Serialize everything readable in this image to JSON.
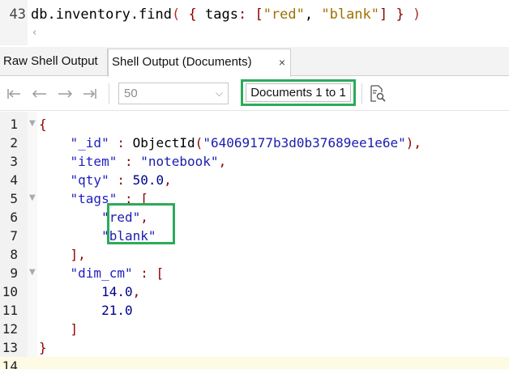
{
  "editor": {
    "line_number": "43",
    "query_parts": [
      {
        "text": "db.inventory.find",
        "cls": "tk-plain"
      },
      {
        "text": "(",
        "cls": "tk-paren"
      },
      {
        "text": " ",
        "cls": "tk-plain"
      },
      {
        "text": "{",
        "cls": "tk-brace"
      },
      {
        "text": " tags",
        "cls": "tk-plain"
      },
      {
        "text": ":",
        "cls": "tk-brace"
      },
      {
        "text": " ",
        "cls": "tk-plain"
      },
      {
        "text": "[",
        "cls": "tk-brace"
      },
      {
        "text": "\"red\"",
        "cls": "tk-str"
      },
      {
        "text": ", ",
        "cls": "tk-plain"
      },
      {
        "text": "\"blank\"",
        "cls": "tk-str"
      },
      {
        "text": "]",
        "cls": "tk-brace"
      },
      {
        "text": " ",
        "cls": "tk-plain"
      },
      {
        "text": "}",
        "cls": "tk-brace"
      },
      {
        "text": " ",
        "cls": "tk-plain"
      },
      {
        "text": ")",
        "cls": "tk-paren"
      }
    ]
  },
  "tabs": {
    "raw": "Raw Shell Output",
    "documents": "Shell Output (Documents)",
    "close_glyph": "×"
  },
  "toolbar": {
    "page_size": "50",
    "document_range": "Documents 1 to 1"
  },
  "result_lines": [
    {
      "n": "1",
      "fold": "▼",
      "parts": [
        [
          "{",
          "c-brace"
        ]
      ]
    },
    {
      "n": "2",
      "fold": "",
      "parts": [
        [
          "    ",
          "c-fn"
        ],
        [
          "\"_id\"",
          "c-key"
        ],
        [
          " : ",
          "c-colon"
        ],
        [
          "ObjectId",
          "c-fn"
        ],
        [
          "(",
          "c-punct"
        ],
        [
          "\"64069177b3d0b37689ee1e6e\"",
          "c-arg"
        ],
        [
          "),",
          "c-punct"
        ]
      ]
    },
    {
      "n": "3",
      "fold": "",
      "parts": [
        [
          "    ",
          "c-fn"
        ],
        [
          "\"item\"",
          "c-key"
        ],
        [
          " : ",
          "c-colon"
        ],
        [
          "\"notebook\"",
          "c-str"
        ],
        [
          ",",
          "c-punct"
        ]
      ]
    },
    {
      "n": "4",
      "fold": "",
      "parts": [
        [
          "    ",
          "c-fn"
        ],
        [
          "\"qty\"",
          "c-key"
        ],
        [
          " : ",
          "c-colon"
        ],
        [
          "50.0",
          "c-num"
        ],
        [
          ",",
          "c-punct"
        ]
      ]
    },
    {
      "n": "5",
      "fold": "▼",
      "parts": [
        [
          "    ",
          "c-fn"
        ],
        [
          "\"tags\"",
          "c-key"
        ],
        [
          " : ",
          "c-colon"
        ],
        [
          "[",
          "c-punct"
        ]
      ]
    },
    {
      "n": "6",
      "fold": "",
      "parts": [
        [
          "        ",
          "c-fn"
        ],
        [
          "\"red\"",
          "c-str"
        ],
        [
          ",",
          "c-punct"
        ]
      ]
    },
    {
      "n": "7",
      "fold": "",
      "parts": [
        [
          "        ",
          "c-fn"
        ],
        [
          "\"blank\"",
          "c-str"
        ]
      ]
    },
    {
      "n": "8",
      "fold": "",
      "parts": [
        [
          "    ",
          "c-fn"
        ],
        [
          "],",
          "c-punct"
        ]
      ]
    },
    {
      "n": "9",
      "fold": "▼",
      "parts": [
        [
          "    ",
          "c-fn"
        ],
        [
          "\"dim_cm\"",
          "c-key"
        ],
        [
          " : ",
          "c-colon"
        ],
        [
          "[",
          "c-punct"
        ]
      ]
    },
    {
      "n": "10",
      "fold": "",
      "parts": [
        [
          "        ",
          "c-fn"
        ],
        [
          "14.0",
          "c-num"
        ],
        [
          ",",
          "c-punct"
        ]
      ]
    },
    {
      "n": "11",
      "fold": "",
      "parts": [
        [
          "        ",
          "c-fn"
        ],
        [
          "21.0",
          "c-num"
        ]
      ]
    },
    {
      "n": "12",
      "fold": "",
      "parts": [
        [
          "    ",
          "c-fn"
        ],
        [
          "]",
          "c-punct"
        ]
      ]
    },
    {
      "n": "13",
      "fold": "",
      "parts": [
        [
          "}",
          "c-brace"
        ]
      ]
    },
    {
      "n": "14",
      "fold": "",
      "parts": []
    }
  ],
  "colors": {
    "highlight_box": "#2daa5a",
    "current_line": "#fdfbe4",
    "key": "#1f1fbf",
    "punctuation": "#8b0000"
  },
  "icons": {
    "first": "first-page-icon",
    "prev": "previous-page-icon",
    "next": "next-page-icon",
    "last": "last-page-icon",
    "find": "find-in-documents-icon"
  }
}
